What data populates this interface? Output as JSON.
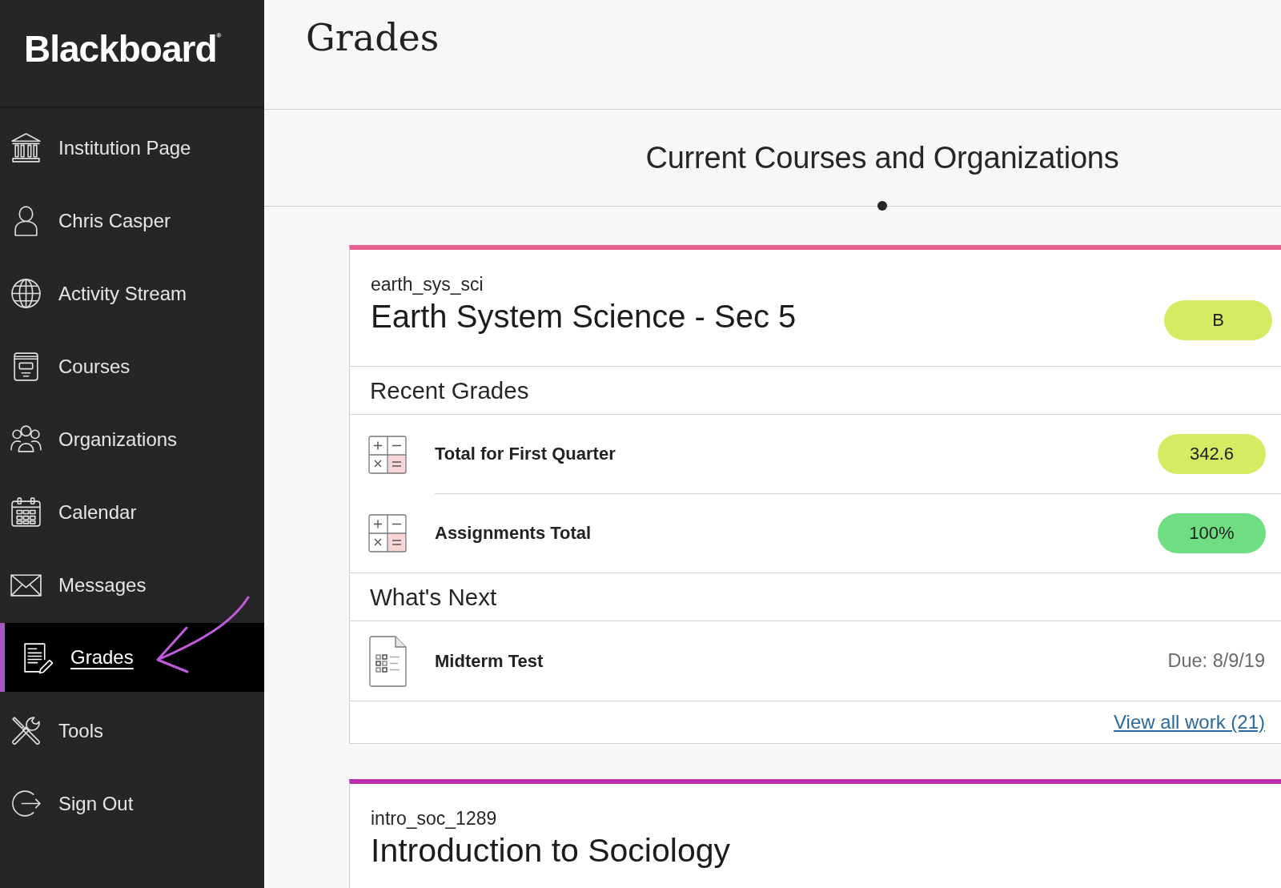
{
  "sidebar": {
    "logo": "Blackboard$^{®}$",
    "items": [
      {
        "label": "Institution Page",
        "selected": false
      },
      {
        "label": "Chris Casper",
        "selected": false
      },
      {
        "label": "Activity Stream",
        "selected": false
      },
      {
        "label": "Courses",
        "selected": false
      },
      {
        "label": "Organizations",
        "selected": false
      },
      {
        "label": "Calendar",
        "selected": false
      },
      {
        "label": "Messages",
        "selected": false
      },
      {
        "label": "Grades",
        "selected": true
      },
      {
        "label": "Tools",
        "selected": false
      },
      {
        "label": "Sign Out",
        "selected": false
      }
    ]
  },
  "header": {
    "title": "Grades"
  },
  "section": {
    "title": "Current Courses and Organizations"
  },
  "courses": [
    {
      "code": "earth_sys_sci",
      "name": "Earth System Science - Sec 5",
      "color": "#e8628f",
      "overall_grade": {
        "value": "B",
        "color": "#d7ea63"
      },
      "recent_grades": {
        "title": "Recent Grades",
        "items": [
          {
            "label": "Total for First Quarter",
            "grade": "342.6",
            "color": "#d7ea63"
          },
          {
            "label": "Assignments Total",
            "grade": "100%",
            "color": "#6fde82"
          }
        ]
      },
      "whats_next": {
        "title": "What's Next",
        "items": [
          {
            "label": "Midterm Test",
            "due": "Due: 8/9/19"
          }
        ]
      },
      "link": "View all work (21)"
    },
    {
      "code": "intro_soc_1289",
      "name": "Introduction to Sociology",
      "color": "#b92fae"
    }
  ]
}
